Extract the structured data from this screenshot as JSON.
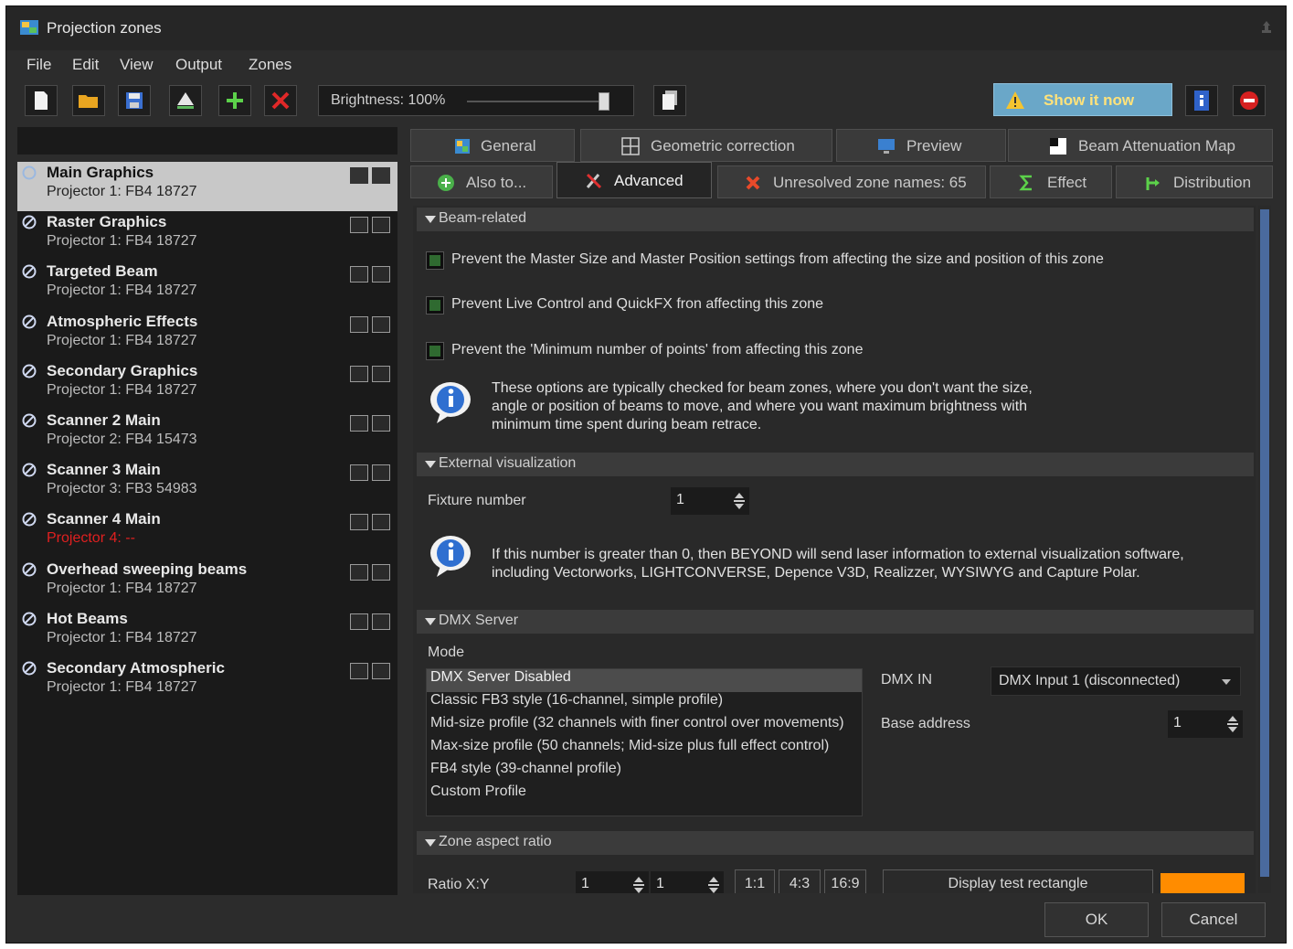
{
  "window": {
    "title": "Projection zones"
  },
  "menu": [
    "File",
    "Edit",
    "View",
    "Output",
    "Zones"
  ],
  "toolbar": {
    "brightness_label": "Brightness: 100%",
    "brightness_value": 100,
    "show_label": "Show it now"
  },
  "zones": [
    {
      "name": "Main Graphics",
      "projector": "Projector 1: FB4 18727",
      "selected": true,
      "error": false
    },
    {
      "name": "Raster Graphics",
      "projector": "Projector 1: FB4 18727",
      "selected": false,
      "error": false
    },
    {
      "name": "Targeted Beam",
      "projector": "Projector 1: FB4 18727",
      "selected": false,
      "error": false
    },
    {
      "name": "Atmospheric Effects",
      "projector": "Projector 1: FB4 18727",
      "selected": false,
      "error": false
    },
    {
      "name": "Secondary Graphics",
      "projector": "Projector 1: FB4 18727",
      "selected": false,
      "error": false
    },
    {
      "name": "Scanner 2 Main",
      "projector": "Projector 2: FB4 15473",
      "selected": false,
      "error": false
    },
    {
      "name": "Scanner 3 Main",
      "projector": "Projector 3: FB3 54983",
      "selected": false,
      "error": false
    },
    {
      "name": "Scanner 4 Main",
      "projector": "Projector 4: --",
      "selected": false,
      "error": true
    },
    {
      "name": "Overhead sweeping beams",
      "projector": "Projector 1: FB4 18727",
      "selected": false,
      "error": false
    },
    {
      "name": "Hot Beams",
      "projector": "Projector 1: FB4 18727",
      "selected": false,
      "error": false
    },
    {
      "name": "Secondary Atmospheric",
      "projector": "Projector 1: FB4 18727",
      "selected": false,
      "error": false
    }
  ],
  "tabs_row1": [
    "General",
    "Geometric correction",
    "Preview",
    "Beam Attenuation Map"
  ],
  "tabs_row2": [
    "Also to...",
    "Advanced",
    "Unresolved zone names: 65",
    "Effect",
    "Distribution"
  ],
  "beam": {
    "header": "Beam-related",
    "opt1": "Prevent the Master Size and Master Position settings from affecting the size and position of this zone",
    "opt2": "Prevent Live Control and QuickFX fron affecting this zone",
    "opt3": "Prevent the 'Minimum number of points' from affecting this zone",
    "info_line1": "These options are typically checked for beam zones, where you don't want the size,",
    "info_line2": "angle or position of beams to move, and where you want maximum brightness with",
    "info_line3": "minimum time spent during beam retrace."
  },
  "extvis": {
    "header": "External visualization",
    "fixture_label": "Fixture number",
    "fixture_value": "1",
    "info_line1": "If this number is greater than 0, then BEYOND will send laser information to external visualization software,",
    "info_line2": "including Vectorworks, LIGHTCONVERSE, Depence V3D, Realizzer, WYSIWYG and Capture Polar."
  },
  "dmx": {
    "header": "DMX Server",
    "mode_label": "Mode",
    "modes": [
      "DMX Server Disabled",
      "Classic FB3 style (16-channel, simple profile)",
      "Mid-size profile (32 channels with finer control over movements)",
      "Max-size profile (50 channels; Mid-size plus full effect control)",
      "FB4 style (39-channel profile)",
      "Custom Profile"
    ],
    "dmx_in_label": "DMX IN",
    "dmx_in_value": "DMX Input 1 (disconnected)",
    "base_label": "Base address",
    "base_value": "1"
  },
  "aspect": {
    "header": "Zone aspect ratio",
    "ratio_label": "Ratio X:Y",
    "ratio_x": "1",
    "ratio_y": "1",
    "btn_11": "1:1",
    "btn_43": "4:3",
    "btn_169": "16:9",
    "display_btn": "Display test rectangle",
    "color": "#ff8c00"
  },
  "footer": {
    "ok": "OK",
    "cancel": "Cancel"
  }
}
